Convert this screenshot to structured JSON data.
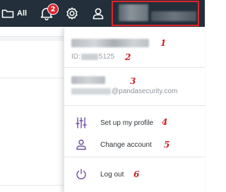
{
  "topbar": {
    "all_label": "All",
    "notification_count": "2"
  },
  "profile": {
    "id_prefix": "ID:",
    "id_suffix": "5125",
    "email_domain": "@pandasecurity.com"
  },
  "menu": {
    "setup_profile": "Set up my profile",
    "change_account": "Change account",
    "log_out": "Log out"
  },
  "annotations": [
    "1",
    "2",
    "3",
    "4",
    "5",
    "6"
  ],
  "colors": {
    "topbar_bg": "#232f3a",
    "highlight_red": "#e0242b",
    "icon_purple": "#6f4fa0"
  }
}
